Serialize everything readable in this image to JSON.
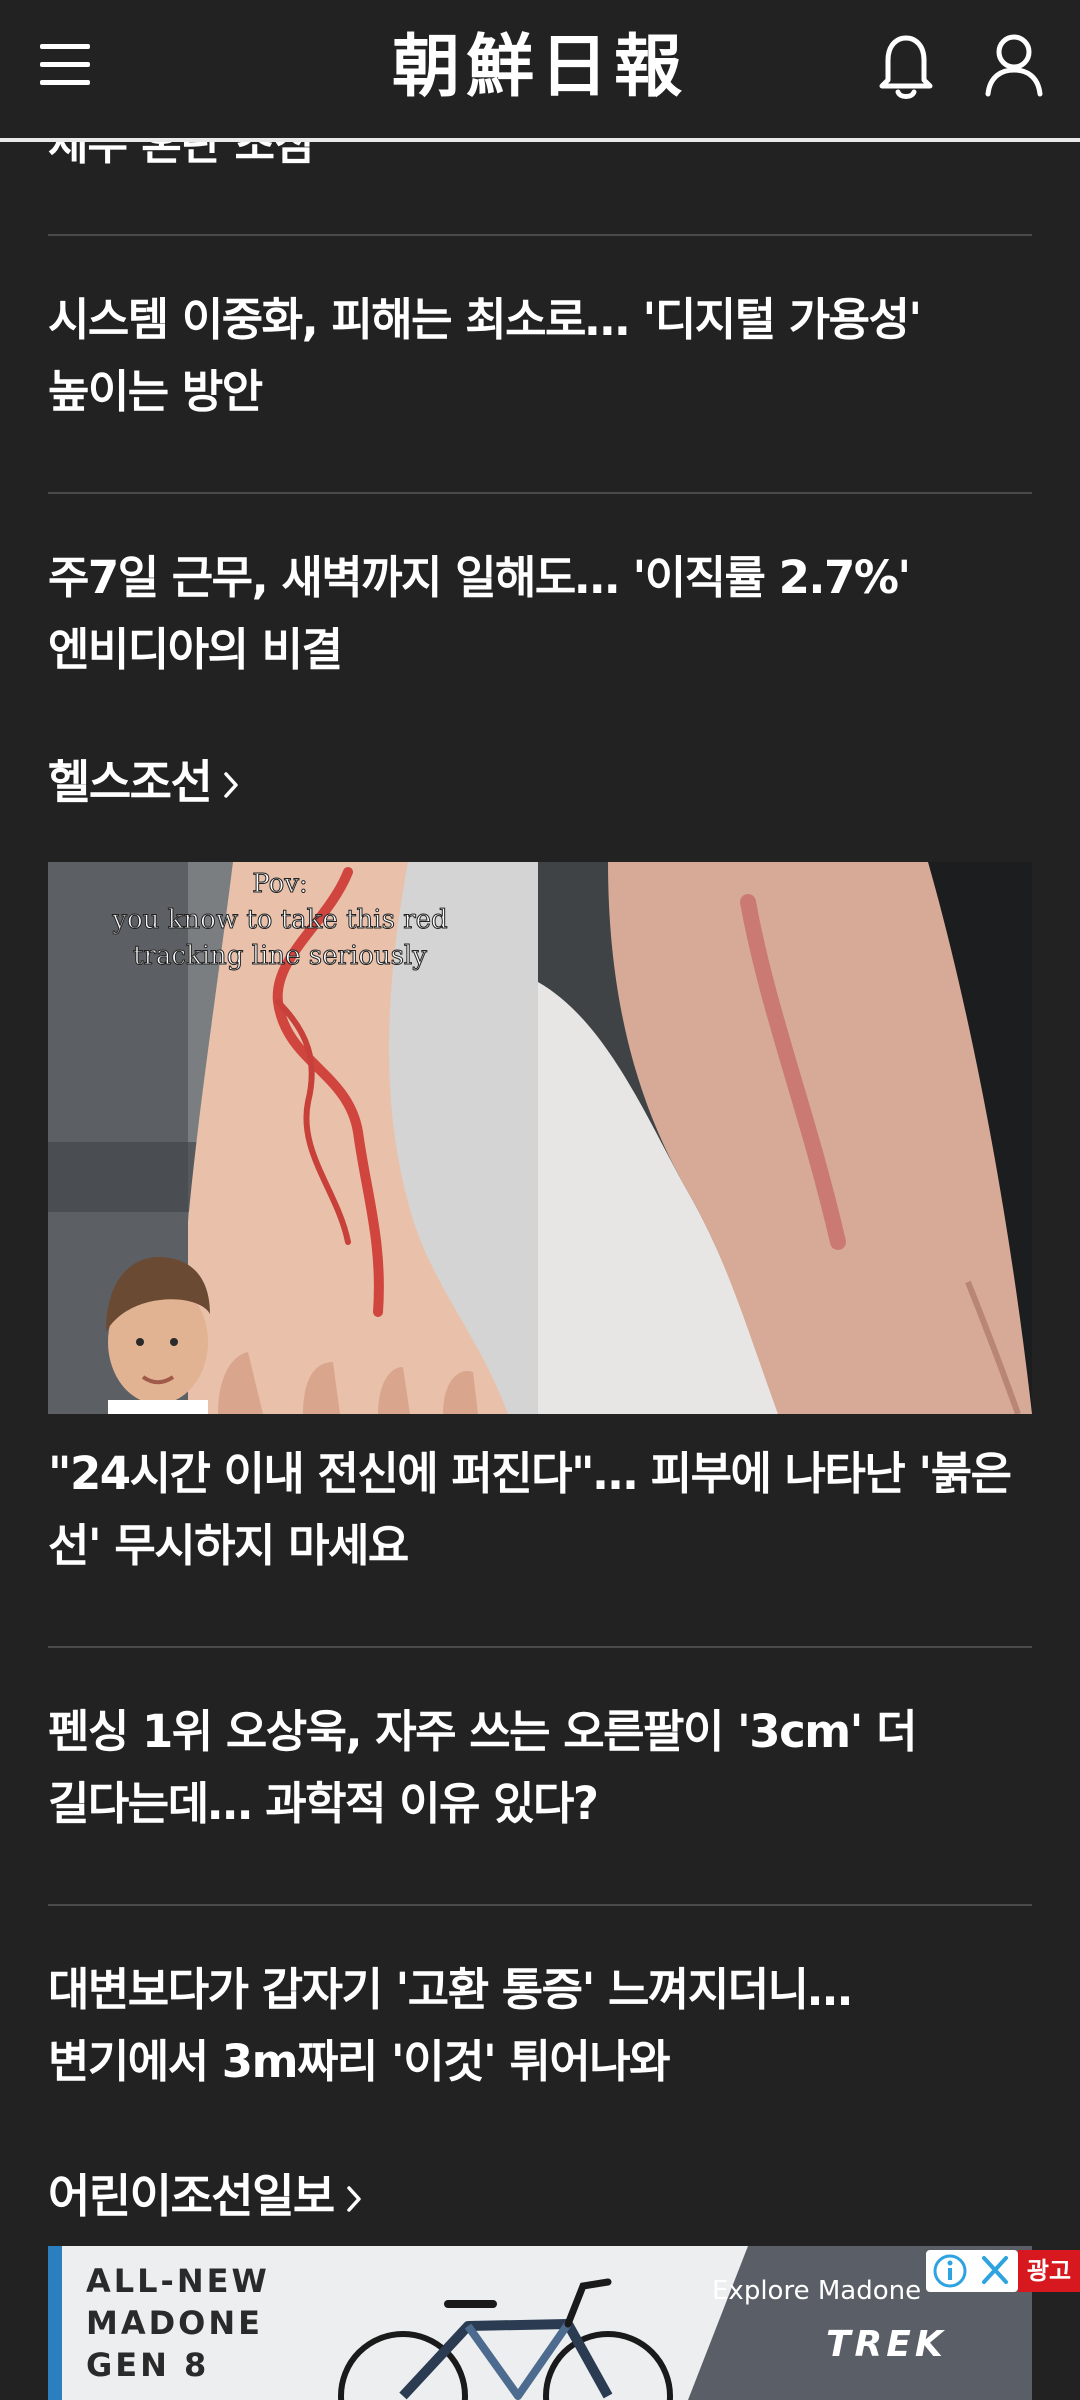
{
  "header": {
    "logo_text": "朝鮮日報",
    "menu_icon": "hamburger-menu-icon",
    "bell_icon": "bell-icon",
    "user_icon": "user-icon"
  },
  "clipped_headline": "세무 혼란 조짐",
  "articles_top": [
    {
      "lines": [
        "시스템 이중화, 피해는 최소로… '디지털 가용성'",
        "높이는 방안"
      ]
    },
    {
      "lines": [
        "주7일 근무, 새벽까지 일해도… '이직률 2.7%'",
        "엔비디아의 비결"
      ]
    }
  ],
  "section_health": {
    "title": "헬스조선"
  },
  "feature": {
    "image_caption_lines": [
      "Pov:",
      "you know to take this red",
      "tracking line seriously"
    ],
    "lines": [
      "\"24시간 이내 전신에 퍼진다\"… 피부에 나타난 '붉은",
      "선' 무시하지 마세요"
    ]
  },
  "articles_health": [
    {
      "lines": [
        "펜싱 1위 오상욱, 자주 쓰는 오른팔이 '3cm' 더",
        "길다는데… 과학적 이유 있다?"
      ]
    },
    {
      "lines": [
        "대변보다가 갑자기 '고환 통증' 느껴지더니…",
        "변기에서 3m짜리 '이것' 튀어나와"
      ]
    }
  ],
  "section_kids": {
    "title": "어린이조선일보"
  },
  "ad": {
    "headline_lines": [
      "ALL-NEW",
      "MADONE",
      "GEN 8"
    ],
    "explore": "Explore Madone",
    "brand": "TREK",
    "badge": "광고"
  },
  "colors": {
    "background": "#222223",
    "text": "#ffffff",
    "divider": "#4a4a4b",
    "ad_badge": "#d7191f"
  }
}
